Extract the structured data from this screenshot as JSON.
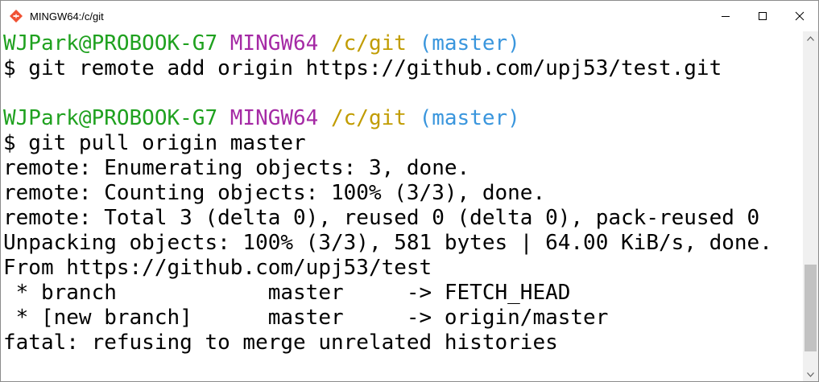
{
  "window": {
    "title": "MINGW64:/c/git",
    "icon": "git-bash-icon",
    "controls": [
      "minimize-icon",
      "maximize-icon",
      "close-icon"
    ]
  },
  "colors": {
    "user": "#1fa11f",
    "shell": "#a52aa5",
    "path": "#c19c00",
    "branch": "#3a96dd",
    "text": "#000000",
    "background": "#ffffff"
  },
  "terminal": {
    "prompt1": {
      "user": "WJPark@PROBOOK-G7",
      "shell": "MINGW64",
      "path": "/c/git",
      "branch": "(master)"
    },
    "command1": "$ git remote add origin https://github.com/upj53/test.git",
    "prompt2": {
      "user": "WJPark@PROBOOK-G7",
      "shell": "MINGW64",
      "path": "/c/git",
      "branch": "(master)"
    },
    "command2": "$ git pull origin master",
    "output": [
      "remote: Enumerating objects: 3, done.",
      "remote: Counting objects: 100% (3/3), done.",
      "remote: Total 3 (delta 0), reused 0 (delta 0), pack-reused 0",
      "Unpacking objects: 100% (3/3), 581 bytes | 64.00 KiB/s, done.",
      "From https://github.com/upj53/test",
      " * branch            master     -> FETCH_HEAD",
      " * [new branch]      master     -> origin/master",
      "fatal: refusing to merge unrelated histories"
    ]
  }
}
